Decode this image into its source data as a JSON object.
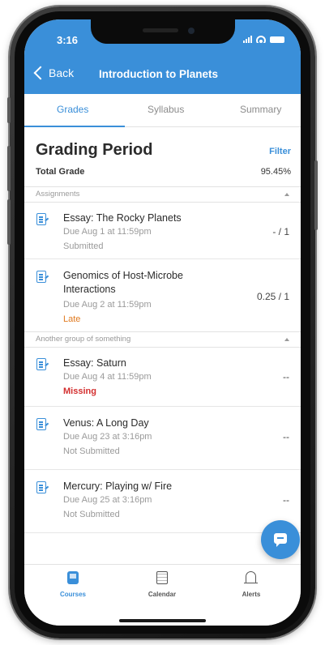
{
  "status_bar": {
    "time": "3:16"
  },
  "nav": {
    "back_label": "Back",
    "title": "Introduction to Planets"
  },
  "tabs": [
    {
      "label": "Grades",
      "active": true
    },
    {
      "label": "Syllabus",
      "active": false
    },
    {
      "label": "Summary",
      "active": false
    }
  ],
  "grading": {
    "title": "Grading Period",
    "filter_label": "Filter",
    "total_label": "Total Grade",
    "total_value": "95.45%"
  },
  "groups": [
    {
      "label": "Assignments",
      "items": [
        {
          "title": "Essay: The Rocky Planets",
          "due": "Due Aug 1 at 11:59pm",
          "status": "Submitted",
          "status_color": "#9a9a9a",
          "score": "- / 1"
        },
        {
          "title": "Genomics of Host-Microbe Interactions",
          "due": "Due Aug 2 at 11:59pm",
          "status": "Late",
          "status_color": "#e07a1f",
          "score": "0.25 / 1"
        }
      ]
    },
    {
      "label": "Another group of something",
      "items": [
        {
          "title": "Essay: Saturn",
          "due": "Due Aug 4 at 11:59pm",
          "status": "Missing",
          "status_color": "#d32f2f",
          "score": "--"
        },
        {
          "title": "Venus: A Long Day",
          "due": "Due Aug 23 at 3:16pm",
          "status": "Not Submitted",
          "status_color": "#9a9a9a",
          "score": "--"
        },
        {
          "title": "Mercury: Playing w/ Fire",
          "due": "Due Aug 25 at 3:16pm",
          "status": "Not Submitted",
          "status_color": "#9a9a9a",
          "score": "--"
        }
      ]
    }
  ],
  "bottom_tabs": [
    {
      "label": "Courses",
      "icon": "courses-icon",
      "active": true
    },
    {
      "label": "Calendar",
      "icon": "calendar-icon",
      "active": false
    },
    {
      "label": "Alerts",
      "icon": "bell-icon",
      "active": false
    }
  ],
  "colors": {
    "accent": "#3a8fd9"
  }
}
